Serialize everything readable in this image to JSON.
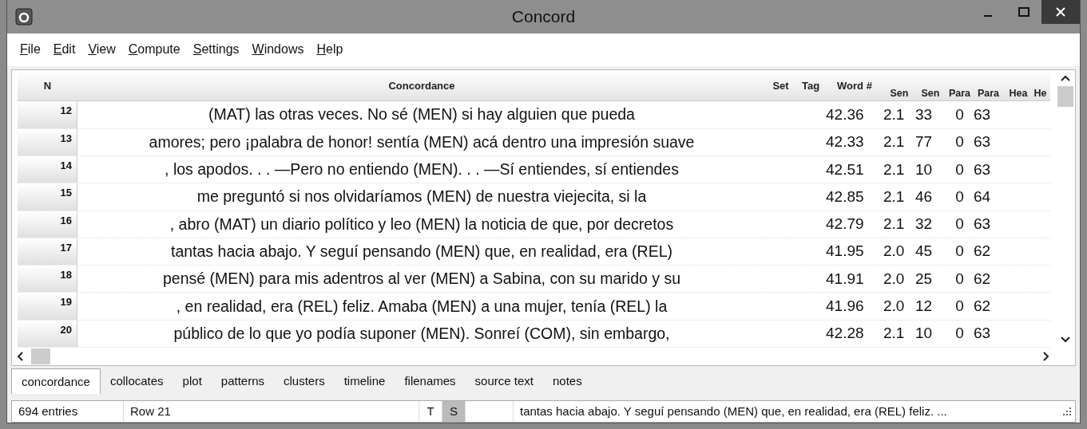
{
  "window": {
    "title": "Concord"
  },
  "menu": [
    {
      "label": "File"
    },
    {
      "label": "Edit"
    },
    {
      "label": "View"
    },
    {
      "label": "Compute"
    },
    {
      "label": "Settings"
    },
    {
      "label": "Windows"
    },
    {
      "label": "Help"
    }
  ],
  "table": {
    "columns": [
      "N",
      "Concordance",
      "Set",
      "Tag",
      "Word #",
      "Sen",
      "Sen",
      "Para",
      "Para",
      "Hea",
      "He"
    ],
    "rows": [
      {
        "n": "12",
        "concordance": "(MAT) las otras veces. No sé (MEN) si hay alguien que pueda",
        "word": "42.36",
        "sent1": "2.1",
        "sent2": "33",
        "para1": "0",
        "para2": "63"
      },
      {
        "n": "13",
        "concordance": "amores; pero ¡palabra de honor! sentía (MEN) acá dentro una impresión suave",
        "word": "42.33",
        "sent1": "2.1",
        "sent2": "77",
        "para1": "0",
        "para2": "63"
      },
      {
        "n": "14",
        "concordance": ", los apodos. . . —Pero no entiendo (MEN). . . —Sí entiendes, sí entiendes",
        "word": "42.51",
        "sent1": "2.1",
        "sent2": "10",
        "para1": "0",
        "para2": "63"
      },
      {
        "n": "15",
        "concordance": "me preguntó si nos olvidaríamos (MEN) de nuestra viejecita, si la",
        "word": "42.85",
        "sent1": "2.1",
        "sent2": "46",
        "para1": "0",
        "para2": "64"
      },
      {
        "n": "16",
        "concordance": ", abro (MAT) un diario político y leo (MEN) la noticia de que, por decretos",
        "word": "42.79",
        "sent1": "2.1",
        "sent2": "32",
        "para1": "0",
        "para2": "63"
      },
      {
        "n": "17",
        "concordance": "tantas hacia abajo. Y seguí pensando (MEN) que, en realidad, era (REL)",
        "word": "41.95",
        "sent1": "2.0",
        "sent2": "45",
        "para1": "0",
        "para2": "62"
      },
      {
        "n": "18",
        "concordance": "pensé (MEN) para mis adentros al ver (MEN) a Sabina, con su marido y su",
        "word": "41.91",
        "sent1": "2.0",
        "sent2": "25",
        "para1": "0",
        "para2": "62"
      },
      {
        "n": "19",
        "concordance": ", en realidad, era (REL) feliz. Amaba (MEN) a una mujer, tenía (REL) la",
        "word": "41.96",
        "sent1": "2.0",
        "sent2": "12",
        "para1": "0",
        "para2": "62"
      },
      {
        "n": "20",
        "concordance": "público de lo que yo podía suponer (MEN). Sonreí (COM), sin embargo,",
        "word": "42.28",
        "sent1": "2.1",
        "sent2": "10",
        "para1": "0",
        "para2": "63"
      }
    ]
  },
  "tabs": [
    {
      "label": "concordance",
      "selected": true
    },
    {
      "label": "collocates",
      "selected": false
    },
    {
      "label": "plot",
      "selected": false
    },
    {
      "label": "patterns",
      "selected": false
    },
    {
      "label": "clusters",
      "selected": false
    },
    {
      "label": "timeline",
      "selected": false
    },
    {
      "label": "filenames",
      "selected": false
    },
    {
      "label": "source text",
      "selected": false
    },
    {
      "label": "notes",
      "selected": false
    }
  ],
  "status_bar": {
    "entries": "694 entries",
    "row": "Row 21",
    "flags": [
      {
        "label": "T",
        "on": false
      },
      {
        "label": "S",
        "on": true
      }
    ],
    "text": "tantas hacia abajo. Y seguí pensando (MEN) que, en realidad, era (REL) feliz. ..."
  }
}
